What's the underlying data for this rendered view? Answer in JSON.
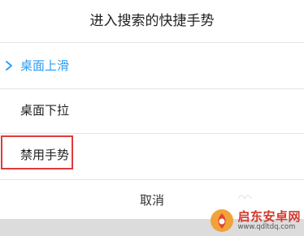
{
  "dialog": {
    "title": "进入搜索的快捷手势",
    "options": [
      {
        "label": "桌面上滑",
        "selected": true
      },
      {
        "label": "桌面下拉",
        "selected": false
      },
      {
        "label": "禁用手势",
        "selected": false
      }
    ],
    "cancel_label": "取消"
  },
  "watermark": {
    "name": "启东安卓网",
    "url": "www.qdltdq.com"
  },
  "colors": {
    "accent": "#2a9df4",
    "highlight_border": "#e03a3a",
    "watermark_red": "#d23a2e"
  },
  "icons": {
    "selected_marker": "chevron-right-icon",
    "logo": "watermark-logo-icon"
  }
}
